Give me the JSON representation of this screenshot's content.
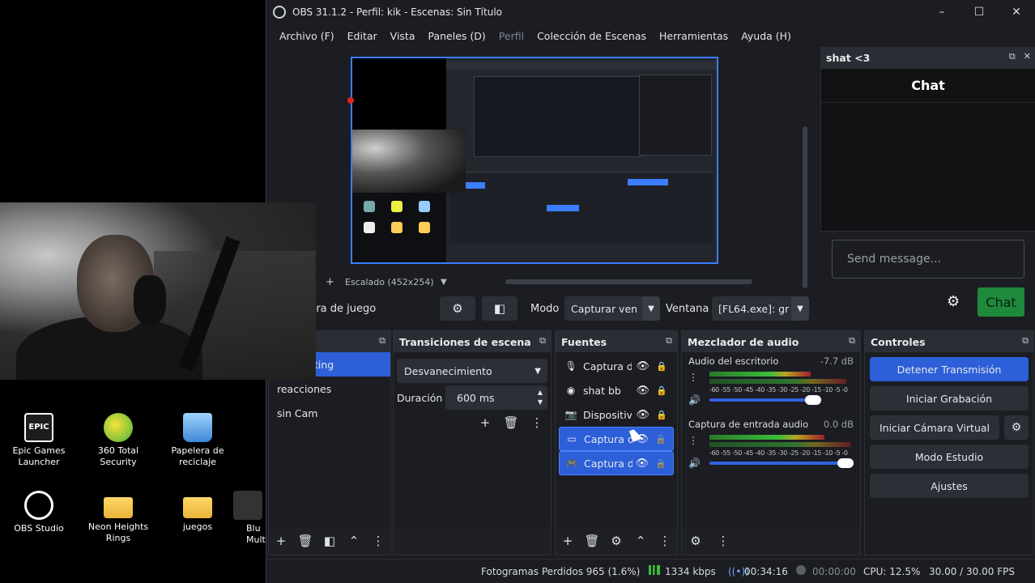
{
  "desktop": {
    "icons": [
      {
        "label": "Epic Games Launcher",
        "icon": "epic-games-icon"
      },
      {
        "label": "360 Total Security",
        "icon": "shield-plus-icon"
      },
      {
        "label": "Papelera de reciclaje",
        "icon": "recycle-bin-icon"
      },
      {
        "label": "OBS Studio",
        "icon": "obs-icon"
      },
      {
        "label": "Neon Heights Rings",
        "icon": "folder-icon"
      },
      {
        "label": "juegos",
        "icon": "folder-icon"
      },
      {
        "label": "Blu Mult",
        "icon": "app-icon"
      }
    ],
    "epic_logo_text": "EPIC"
  },
  "window": {
    "title": "OBS 31.1.2 - Perfil: kik - Escenas: Sin Título",
    "controls": {
      "minimize": "–",
      "maximize": "☐",
      "close": "✕"
    }
  },
  "menu": [
    "Archivo (F)",
    "Editar",
    "Vista",
    "Paneles (D)",
    "Perfil",
    "Colección de Escenas",
    "Herramientas",
    "Ayuda (H)"
  ],
  "preview": {
    "scale_label": "Escalado (452x254)",
    "add_symbol": "+",
    "dropdown_symbol": "▼"
  },
  "source_toolbar": {
    "source_name": "tura de juego",
    "gear": "⚙",
    "props": "◧",
    "mode_label": "Modo",
    "mode_value": "Capturar ven",
    "window_label": "Ventana",
    "window_value": "[FL64.exe]: gr",
    "caret": "▼"
  },
  "chat": {
    "dock_title": "shat <3",
    "header": "Chat",
    "input_placeholder": "Send message...",
    "send_label": "Chat",
    "settings_icon": "gear-icon"
  },
  "scenes": {
    "items": [
      "ting",
      "reacciones",
      "sin Cam"
    ],
    "active_index": 0,
    "footer": [
      "+",
      "🗑",
      "◧",
      "⌃",
      "⋮"
    ]
  },
  "transitions": {
    "title": "Transiciones de escena",
    "selected": "Desvanecimiento",
    "duration_label": "Duración",
    "duration_value": "600 ms",
    "tools": [
      "+",
      "🗑",
      "⋮"
    ]
  },
  "sources": {
    "title": "Fuentes",
    "items": [
      {
        "icon": "🎙",
        "label": "Captura d",
        "selected": false,
        "locked_dim": false
      },
      {
        "icon": "◉",
        "label": "shat bb",
        "selected": false,
        "locked_dim": false
      },
      {
        "icon": "📷",
        "label": "Dispositiv",
        "selected": false,
        "locked_dim": false
      },
      {
        "icon": "▭",
        "label": "Captura d",
        "selected": true,
        "locked_dim": true
      },
      {
        "icon": "🎮",
        "label": "Captura d",
        "selected": true,
        "locked_dim": true
      }
    ],
    "footer": [
      "+",
      "🗑",
      "⚙",
      "⌃",
      "⋮"
    ]
  },
  "mixer": {
    "title": "Mezclador de audio",
    "tracks": [
      {
        "name": "Audio del escritorio",
        "db": "-7.7 dB",
        "fader": 0.72
      },
      {
        "name": "Captura de entrada audio",
        "db": "0.0 dB",
        "fader": 1.0
      }
    ],
    "ticks": "-60 -55 -50 -45 -40 -35 -30 -25 -20 -15 -10 -5 -0",
    "footer": [
      "⚙",
      "⋮"
    ]
  },
  "controls": {
    "title": "Controles",
    "stop_stream": "Detener Transmisión",
    "start_recording": "Iniciar Grabación",
    "start_virtual_cam": "Iniciar Cámara Virtual",
    "studio_mode": "Modo Estudio",
    "settings": "Ajustes"
  },
  "status": {
    "dropped_frames": "Fotogramas Perdidos 965 (1.6%)",
    "bitrate": "1334 kbps",
    "stream_time": "00:34:16",
    "rec_time": "00:00:00",
    "cpu": "CPU: 12.5%",
    "fps": "30.00 / 30.00 FPS"
  }
}
